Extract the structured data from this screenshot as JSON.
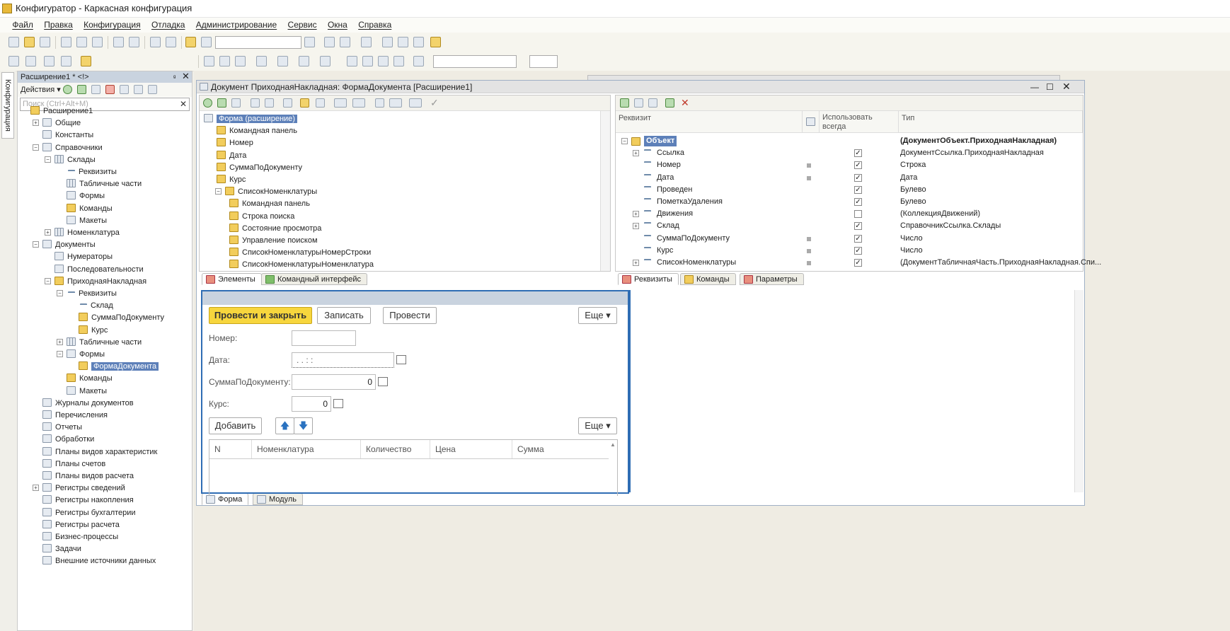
{
  "window_title": "Конфигуратор - Каркасная конфигурация",
  "menu": [
    "Файл",
    "Правка",
    "Конфигурация",
    "Отладка",
    "Администрирование",
    "Сервис",
    "Окна",
    "Справка"
  ],
  "side_tab_label": "Конфигурация",
  "left_panel": {
    "title": "Расширение1 * <!>",
    "pin": "ᵍ",
    "actions_label": "Действия ▾",
    "search_placeholder": "Поиск (Ctrl+Alt+M)",
    "tree": [
      {
        "label": "Расширение1",
        "level": 0,
        "icon": "extension-icon",
        "exp": ""
      },
      {
        "label": "Общие",
        "level": 1,
        "icon": "common-icon",
        "exp": "+"
      },
      {
        "label": "Константы",
        "level": 1,
        "icon": "constants-icon",
        "exp": ""
      },
      {
        "label": "Справочники",
        "level": 1,
        "icon": "catalogs-icon",
        "exp": "−"
      },
      {
        "label": "Склады",
        "level": 2,
        "icon": "catalog-icon",
        "exp": "−"
      },
      {
        "label": "Реквизиты",
        "level": 3,
        "icon": "attribute-icon",
        "exp": ""
      },
      {
        "label": "Табличные части",
        "level": 3,
        "icon": "table-icon",
        "exp": ""
      },
      {
        "label": "Формы",
        "level": 3,
        "icon": "form-icon",
        "exp": ""
      },
      {
        "label": "Команды",
        "level": 3,
        "icon": "command-icon",
        "exp": ""
      },
      {
        "label": "Макеты",
        "level": 3,
        "icon": "template-icon",
        "exp": ""
      },
      {
        "label": "Номенклатура",
        "level": 2,
        "icon": "catalog-icon",
        "exp": "+"
      },
      {
        "label": "Документы",
        "level": 1,
        "icon": "documents-icon",
        "exp": "−"
      },
      {
        "label": "Нумераторы",
        "level": 2,
        "icon": "numerator-icon",
        "exp": ""
      },
      {
        "label": "Последовательности",
        "level": 2,
        "icon": "sequence-icon",
        "exp": ""
      },
      {
        "label": "ПриходнаяНакладная",
        "level": 2,
        "icon": "document-icon",
        "exp": "−"
      },
      {
        "label": "Реквизиты",
        "level": 3,
        "icon": "attribute-icon",
        "exp": "−"
      },
      {
        "label": "Склад",
        "level": 4,
        "icon": "attribute-icon",
        "exp": ""
      },
      {
        "label": "СуммаПоДокументу",
        "level": 4,
        "icon": "ext-attribute-icon",
        "exp": ""
      },
      {
        "label": "Курс",
        "level": 4,
        "icon": "ext-attribute-icon",
        "exp": ""
      },
      {
        "label": "Табличные части",
        "level": 3,
        "icon": "table-icon",
        "exp": "+"
      },
      {
        "label": "Формы",
        "level": 3,
        "icon": "form-icon",
        "exp": "−"
      },
      {
        "label": "ФормаДокумента",
        "level": 4,
        "icon": "ext-form-icon",
        "exp": "",
        "selected": true
      },
      {
        "label": "Команды",
        "level": 3,
        "icon": "command-icon",
        "exp": ""
      },
      {
        "label": "Макеты",
        "level": 3,
        "icon": "template-icon",
        "exp": ""
      },
      {
        "label": "Журналы документов",
        "level": 1,
        "icon": "journal-icon",
        "exp": ""
      },
      {
        "label": "Перечисления",
        "level": 1,
        "icon": "enum-icon",
        "exp": ""
      },
      {
        "label": "Отчеты",
        "level": 1,
        "icon": "report-icon",
        "exp": ""
      },
      {
        "label": "Обработки",
        "level": 1,
        "icon": "processing-icon",
        "exp": ""
      },
      {
        "label": "Планы видов характеристик",
        "level": 1,
        "icon": "chart-of-characteristics-icon",
        "exp": ""
      },
      {
        "label": "Планы счетов",
        "level": 1,
        "icon": "chart-of-accounts-icon",
        "exp": ""
      },
      {
        "label": "Планы видов расчета",
        "level": 1,
        "icon": "calc-types-icon",
        "exp": ""
      },
      {
        "label": "Регистры сведений",
        "level": 1,
        "icon": "info-register-icon",
        "exp": "+"
      },
      {
        "label": "Регистры накопления",
        "level": 1,
        "icon": "accum-register-icon",
        "exp": ""
      },
      {
        "label": "Регистры бухгалтерии",
        "level": 1,
        "icon": "acc-register-icon",
        "exp": ""
      },
      {
        "label": "Регистры расчета",
        "level": 1,
        "icon": "calc-register-icon",
        "exp": ""
      },
      {
        "label": "Бизнес-процессы",
        "level": 1,
        "icon": "business-process-icon",
        "exp": ""
      },
      {
        "label": "Задачи",
        "level": 1,
        "icon": "task-icon",
        "exp": ""
      },
      {
        "label": "Внешние источники данных",
        "level": 1,
        "icon": "external-source-icon",
        "exp": ""
      }
    ]
  },
  "form_window": {
    "title": "Документ ПриходнаяНакладная: ФормаДокумента [Расширение1]",
    "elements_tree": [
      {
        "label": "Форма (расширение)",
        "level": 0,
        "selected": true,
        "exp": ""
      },
      {
        "label": "Командная панель",
        "level": 1,
        "exp": ""
      },
      {
        "label": "Номер",
        "level": 1,
        "exp": ""
      },
      {
        "label": "Дата",
        "level": 1,
        "exp": ""
      },
      {
        "label": "СуммаПоДокументу",
        "level": 1,
        "exp": ""
      },
      {
        "label": "Курс",
        "level": 1,
        "exp": ""
      },
      {
        "label": "СписокНоменклатуры",
        "level": 1,
        "exp": "−"
      },
      {
        "label": "Командная панель",
        "level": 2,
        "exp": ""
      },
      {
        "label": "Строка поиска",
        "level": 2,
        "exp": ""
      },
      {
        "label": "Состояние просмотра",
        "level": 2,
        "exp": ""
      },
      {
        "label": "Управление поиском",
        "level": 2,
        "exp": ""
      },
      {
        "label": "СписокНоменклатурыНомерСтроки",
        "level": 2,
        "exp": ""
      },
      {
        "label": "СписокНоменклатурыНоменклатура",
        "level": 2,
        "exp": ""
      }
    ],
    "left_tabs": [
      "Элементы",
      "Командный интерфейс"
    ],
    "attr_headers": {
      "name": "Реквизит",
      "use": "Использовать всегда",
      "type": "Тип"
    },
    "attributes": [
      {
        "name": "Объект",
        "level": 0,
        "exp": "−",
        "dot": false,
        "checked": null,
        "type": "(ДокументОбъект.ПриходнаяНакладная)",
        "bold": true
      },
      {
        "name": "Ссылка",
        "level": 1,
        "exp": "+",
        "dot": false,
        "checked": true,
        "type": "ДокументСсылка.ПриходнаяНакладная"
      },
      {
        "name": "Номер",
        "level": 1,
        "exp": "",
        "dot": true,
        "checked": true,
        "type": "Строка"
      },
      {
        "name": "Дата",
        "level": 1,
        "exp": "",
        "dot": true,
        "checked": true,
        "type": "Дата"
      },
      {
        "name": "Проведен",
        "level": 1,
        "exp": "",
        "dot": false,
        "checked": true,
        "type": "Булево"
      },
      {
        "name": "ПометкаУдаления",
        "level": 1,
        "exp": "",
        "dot": false,
        "checked": true,
        "type": "Булево"
      },
      {
        "name": "Движения",
        "level": 1,
        "exp": "+",
        "dot": false,
        "checked": false,
        "type": "(КоллекцияДвижений)"
      },
      {
        "name": "Склад",
        "level": 1,
        "exp": "+",
        "dot": false,
        "checked": true,
        "type": "СправочникСсылка.Склады"
      },
      {
        "name": "СуммаПоДокументу",
        "level": 1,
        "exp": "",
        "dot": true,
        "checked": true,
        "type": "Число"
      },
      {
        "name": "Курс",
        "level": 1,
        "exp": "",
        "dot": true,
        "checked": true,
        "type": "Число"
      },
      {
        "name": "СписокНоменклатуры",
        "level": 1,
        "exp": "+",
        "dot": true,
        "checked": true,
        "type": "(ДокументТабличнаяЧасть.ПриходнаяНакладная.Спи..."
      }
    ],
    "right_tabs": [
      "Реквизиты",
      "Команды",
      "Параметры"
    ],
    "preview": {
      "btn_post_close": "Провести и закрыть",
      "btn_save": "Записать",
      "btn_post": "Провести",
      "btn_more": "Еще ▾",
      "label_number": "Номер:",
      "label_date": "Дата:",
      "date_value": " .  .       :  :",
      "label_sum": "СуммаПоДокументу:",
      "sum_value": "0",
      "label_rate": "Курс:",
      "rate_value": "0",
      "btn_add": "Добавить",
      "btn_more2": "Еще ▾",
      "columns": [
        "N",
        "Номенклатура",
        "Количество",
        "Цена",
        "Сумма"
      ]
    },
    "bottom_tabs": [
      "Форма",
      "Модуль"
    ]
  }
}
